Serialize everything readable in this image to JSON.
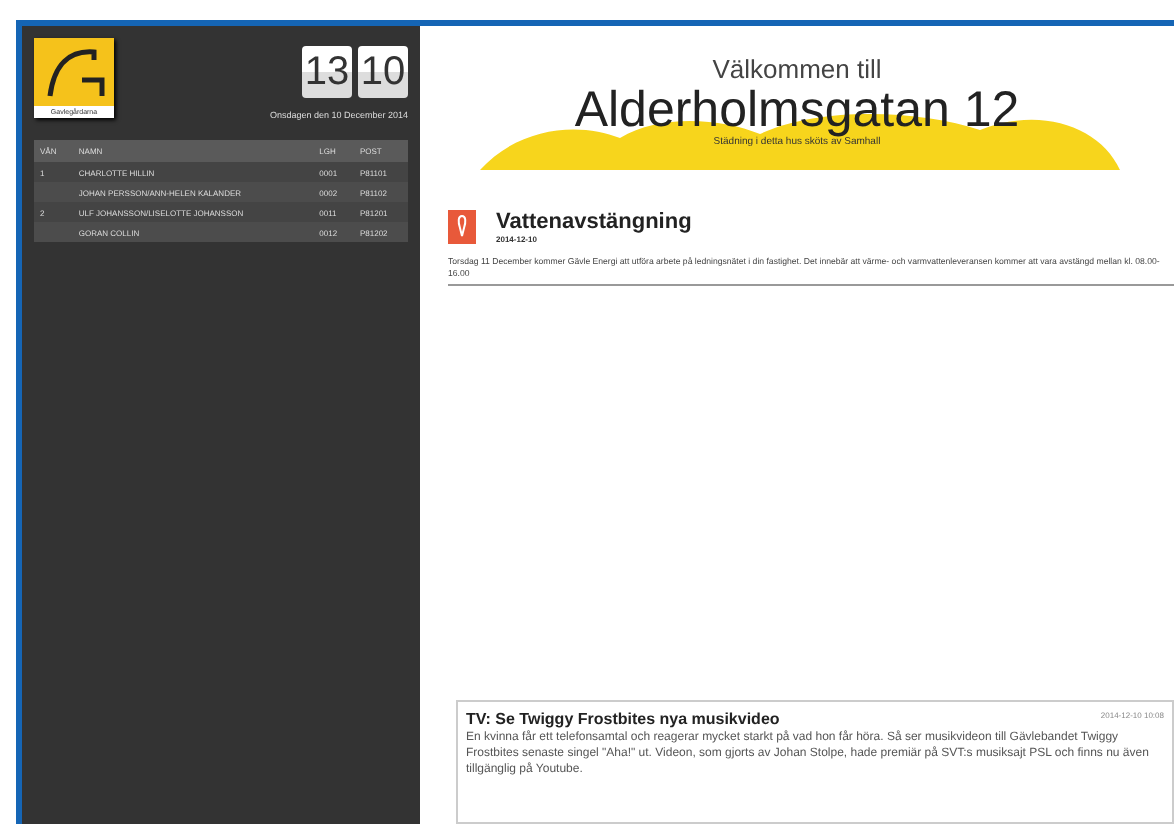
{
  "logo": {
    "caption": "Gavlegårdarna"
  },
  "clock": {
    "hours": "13",
    "minutes": "10"
  },
  "date": "Onsdagen den 10 December 2014",
  "residents": {
    "columns": [
      "VÅN",
      "NAMN",
      "LGH",
      "POST"
    ],
    "rows": [
      {
        "floor": "1",
        "name": "CHARLOTTE HILLIN",
        "apartment": "0001",
        "post": "P81101"
      },
      {
        "name": "JOHAN PERSSON/ANN-HELEN KALANDER",
        "apartment": "0002",
        "post": "P81102"
      },
      {
        "floor": "2",
        "name": "ULF JOHANSSON/LISELOTTE JOHANSSON",
        "apartment": "0011",
        "post": "P81201"
      },
      {
        "name": "GORAN COLLIN",
        "apartment": "0012",
        "post": "P81202"
      }
    ]
  },
  "header": {
    "welcome": "Välkommen till",
    "address": "Alderholmsgatan 12",
    "subtitle": "Städning i detta hus sköts av Samhall"
  },
  "notice": {
    "title": "Vattenavstängning",
    "date": "2014-12-10",
    "body": "Torsdag 11 December kommer Gävle Energi att utföra arbete på ledningsnätet i din fastighet. Det innebär att värme- och varmvattenleveransen kommer att vara avstängd mellan kl. 08.00-16.00"
  },
  "news": {
    "title": "TV: Se Twiggy Frostbites nya musikvideo",
    "date": "2014-12-10 10:08",
    "body": "En kvinna får ett telefonsamtal och reagerar mycket starkt på vad hon får höra. Så ser musikvideon till Gävlebandet Twiggy Frostbites senaste singel \"Aha!\" ut. Videon, som gjorts av Johan Stolpe, hade premiär på SVT:s musiksajt PSL och finns nu även tillgänglig på Youtube."
  }
}
